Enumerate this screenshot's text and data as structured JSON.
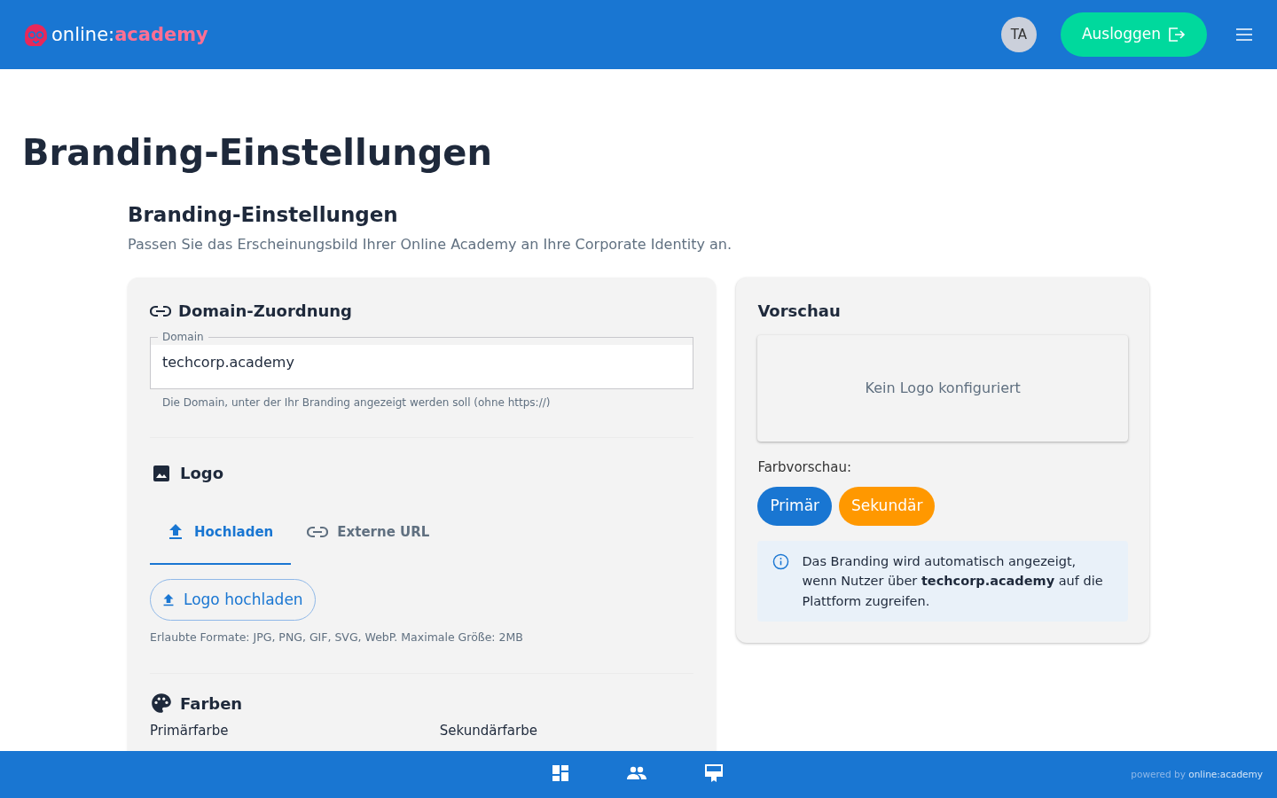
{
  "header": {
    "logo": {
      "part_1": "online:",
      "part_2": "academy"
    },
    "avatar": "TA",
    "logout_button": "Ausloggen"
  },
  "page_title": "Branding-Einstellungen",
  "section": {
    "title": "Branding-Einstellungen",
    "subtitle": "Passen Sie das Erscheinungsbild Ihrer Online Academy an Ihre Corporate Identity an."
  },
  "domain": {
    "title": "Domain-Zuordnung",
    "field_label": "Domain",
    "value": "techcorp.academy",
    "helper": "Die Domain, unter der Ihr Branding angezeigt werden soll (ohne https://)"
  },
  "logo": {
    "title": "Logo",
    "tabs": [
      {
        "label": "Hochladen",
        "kind": "upload",
        "selected": true
      },
      {
        "label": "Externe URL",
        "kind": "link",
        "selected": false
      }
    ],
    "upload_button": "Logo hochladen",
    "hint": "Erlaubte Formate: JPG, PNG, GIF, SVG, WebP. Maximale Größe: 2MB"
  },
  "colors": {
    "title": "Farben",
    "fields": [
      "Primärfarbe",
      "Sekundärfarbe"
    ]
  },
  "preview": {
    "title": "Vorschau",
    "logo_placeholder": "Kein Logo konfiguriert",
    "color_label": "Farbvorschau:",
    "chips": [
      {
        "label": "Primär",
        "color": "#1976d2"
      },
      {
        "label": "Sekundär",
        "color": "#ff9800"
      }
    ],
    "info": "Das Branding wird automatisch angezeigt, wenn Nutzer über **techcorp.academy** auf die Plattform zugreifen."
  },
  "footer": {
    "nav": [
      {
        "kind": "dashboard"
      },
      {
        "kind": "people"
      },
      {
        "kind": "presentation"
      }
    ],
    "powered_by": "powered by",
    "brand": "online:academy"
  }
}
